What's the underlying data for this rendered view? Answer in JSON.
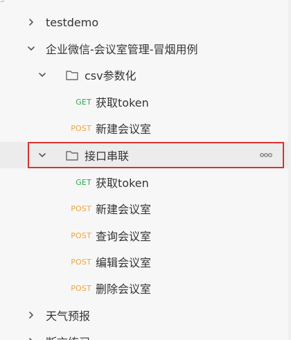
{
  "top_mark": "s",
  "tree": [
    {
      "label": "testdemo",
      "method": "",
      "expanded": false
    },
    {
      "label": "企业微信-会议室管理-冒烟用例",
      "method": "",
      "expanded": true
    },
    {
      "label": "csv参数化",
      "method": "",
      "expanded": true
    },
    {
      "label": "获取token",
      "method": "GET"
    },
    {
      "label": "新建会议室",
      "method": "POST"
    },
    {
      "label": "接口串联",
      "method": "",
      "expanded": true,
      "selected": true
    },
    {
      "label": "获取token",
      "method": "GET"
    },
    {
      "label": "新建会议室",
      "method": "POST"
    },
    {
      "label": "查询会议室",
      "method": "POST"
    },
    {
      "label": "编辑会议室",
      "method": "POST"
    },
    {
      "label": "删除会议室",
      "method": "POST"
    },
    {
      "label": "天气预报",
      "method": "",
      "expanded": false
    },
    {
      "label": "断言练习",
      "method": "",
      "expanded": false
    }
  ],
  "colors": {
    "get": "#2aa84a",
    "post": "#f0a43a",
    "highlight": "#d9312f",
    "text": "#333333"
  }
}
